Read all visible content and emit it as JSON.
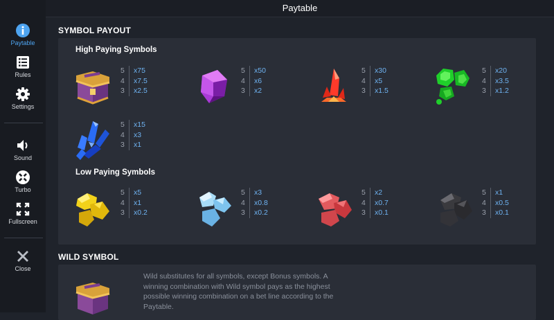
{
  "header": {
    "title": "Paytable"
  },
  "sidebar": {
    "items": [
      {
        "label": "Paytable",
        "icon": "info-icon",
        "active": true
      },
      {
        "label": "Rules",
        "icon": "list-icon"
      },
      {
        "label": "Settings",
        "icon": "gear-icon"
      },
      {
        "label": "Sound",
        "icon": "speaker-icon"
      },
      {
        "label": "Turbo",
        "icon": "turbo-icon"
      },
      {
        "label": "Fullscreen",
        "icon": "fullscreen-icon"
      },
      {
        "label": "Close",
        "icon": "close-icon"
      }
    ]
  },
  "symbol_payout": {
    "title": "SYMBOL PAYOUT",
    "high_title": "High Paying Symbols",
    "low_title": "Low Paying Symbols",
    "high": [
      {
        "name": "treasure-chest",
        "pays": [
          [
            "5",
            "x75"
          ],
          [
            "4",
            "x7.5"
          ],
          [
            "3",
            "x2.5"
          ]
        ]
      },
      {
        "name": "purple-gem",
        "pays": [
          [
            "5",
            "x50"
          ],
          [
            "4",
            "x6"
          ],
          [
            "3",
            "x2"
          ]
        ]
      },
      {
        "name": "red-crystal",
        "pays": [
          [
            "5",
            "x30"
          ],
          [
            "4",
            "x5"
          ],
          [
            "3",
            "x1.5"
          ]
        ]
      },
      {
        "name": "green-gems",
        "pays": [
          [
            "5",
            "x20"
          ],
          [
            "4",
            "x3.5"
          ],
          [
            "3",
            "x1.2"
          ]
        ]
      },
      {
        "name": "blue-crystals",
        "pays": [
          [
            "5",
            "x15"
          ],
          [
            "4",
            "x3"
          ],
          [
            "3",
            "x1"
          ]
        ]
      }
    ],
    "low": [
      {
        "name": "gold-ore",
        "pays": [
          [
            "5",
            "x5"
          ],
          [
            "4",
            "x1"
          ],
          [
            "3",
            "x0.2"
          ]
        ]
      },
      {
        "name": "ice-ore",
        "pays": [
          [
            "5",
            "x3"
          ],
          [
            "4",
            "x0.8"
          ],
          [
            "3",
            "x0.2"
          ]
        ]
      },
      {
        "name": "ruby-ore",
        "pays": [
          [
            "5",
            "x2"
          ],
          [
            "4",
            "x0.7"
          ],
          [
            "3",
            "x0.1"
          ]
        ]
      },
      {
        "name": "coal-ore",
        "pays": [
          [
            "5",
            "x1"
          ],
          [
            "4",
            "x0.5"
          ],
          [
            "3",
            "x0.1"
          ]
        ]
      }
    ]
  },
  "wild": {
    "title": "WILD SYMBOL",
    "text": "Wild substitutes for all symbols, except Bonus symbols. A winning combination with Wild symbol pays as the highest possible winning combination on a bet line according to the Paytable."
  },
  "colors": {
    "accent": "#4ea4f0",
    "payout": "#6fb3f2",
    "panel": "#2a2e37",
    "background": "#1f232b"
  }
}
